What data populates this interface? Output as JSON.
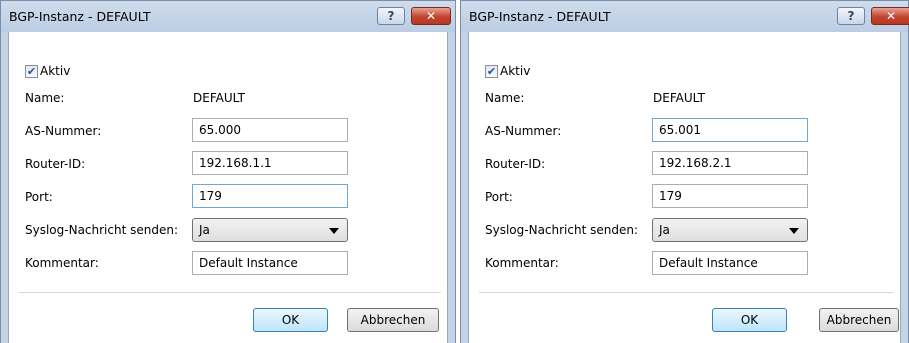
{
  "dialogs": [
    {
      "title": "BGP-Instanz - DEFAULT",
      "help_label": "?",
      "close_label": "✕",
      "active_checked": true,
      "active_label": "Aktiv",
      "name_label": "Name:",
      "name_value": "DEFAULT",
      "as_label": "AS-Nummer:",
      "as_value": "65.000",
      "router_label": "Router-ID:",
      "router_value": "192.168.1.1",
      "port_label": "Port:",
      "port_value": "179",
      "syslog_label": "Syslog-Nachricht senden:",
      "syslog_value": "Ja",
      "comment_label": "Kommentar:",
      "comment_value": "Default Instance",
      "ok_label": "OK",
      "cancel_label": "Abbrechen",
      "focused_field": "port"
    },
    {
      "title": "BGP-Instanz - DEFAULT",
      "help_label": "?",
      "close_label": "✕",
      "active_checked": true,
      "active_label": "Aktiv",
      "name_label": "Name:",
      "name_value": "DEFAULT",
      "as_label": "AS-Nummer:",
      "as_value": "65.001",
      "router_label": "Router-ID:",
      "router_value": "192.168.2.1",
      "port_label": "Port:",
      "port_value": "179",
      "syslog_label": "Syslog-Nachricht senden:",
      "syslog_value": "Ja",
      "comment_label": "Kommentar:",
      "comment_value": "Default Instance",
      "ok_label": "OK",
      "cancel_label": "Abbrechen",
      "focused_field": "as"
    }
  ]
}
